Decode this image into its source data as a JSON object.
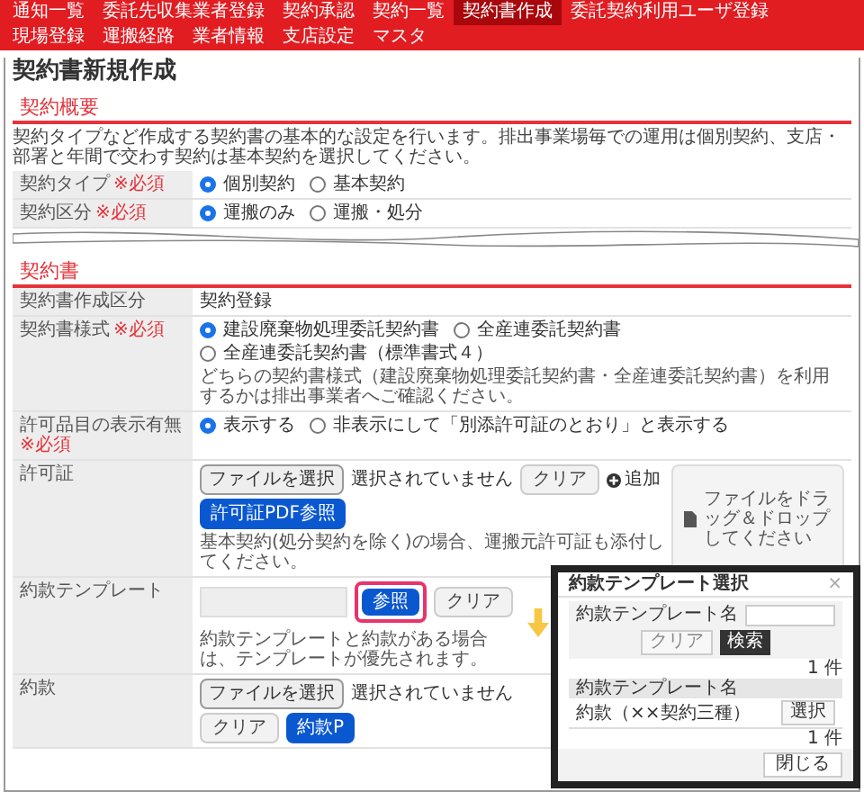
{
  "nav": [
    {
      "label": "通知一覧",
      "selected": false
    },
    {
      "label": "委託先収集業者登録",
      "selected": false
    },
    {
      "label": "契約承認",
      "selected": false
    },
    {
      "label": "契約一覧",
      "selected": false
    },
    {
      "label": "契約書作成",
      "selected": true
    },
    {
      "label": "委託契約利用ユーザ登録",
      "selected": false
    },
    {
      "label": "現場登録",
      "selected": false
    },
    {
      "label": "運搬経路",
      "selected": false
    },
    {
      "label": "業者情報",
      "selected": false
    },
    {
      "label": "支店設定",
      "selected": false
    },
    {
      "label": "マスタ",
      "selected": false
    }
  ],
  "page_title": "契約書新規作成",
  "overview": {
    "heading": "契約概要",
    "description": "契約タイプなど作成する契約書の基本的な設定を行います。排出事業場毎での運用は個別契約、支店・部署と年間で交わす契約は基本契約を選択してください。",
    "rows": [
      {
        "kind": "radio",
        "label": "契約タイプ",
        "required": "※必須",
        "options": [
          {
            "label": "個別契約",
            "selected": true
          },
          {
            "label": "基本契約",
            "selected": false
          }
        ]
      },
      {
        "kind": "radio",
        "label": "契約区分",
        "required": "※必須",
        "options": [
          {
            "label": "運搬のみ",
            "selected": true
          },
          {
            "label": "運搬・処分",
            "selected": false
          }
        ]
      }
    ]
  },
  "contract": {
    "heading": "契約書",
    "rows": [
      {
        "kind": "text",
        "label": "契約書作成区分",
        "value": "契約登録"
      },
      {
        "kind": "radio",
        "label": "契約書様式",
        "required": "※必須",
        "options": [
          {
            "label": "建設廃棄物処理委託契約書",
            "selected": true
          },
          {
            "label": "全産連委託契約書",
            "selected": false
          },
          {
            "label": "全産連委託契約書（標準書式４）",
            "selected": false
          }
        ],
        "note": "どちらの契約書様式（建設廃棄物処理委託契約書・全産連委託契約書）を利用するかは排出事業者へご確認ください。"
      },
      {
        "kind": "radio",
        "label": "許可品目の表示有無",
        "required": "※必須",
        "options": [
          {
            "label": "表示する",
            "selected": true
          },
          {
            "label": "非表示にして「別添許可証のとおり」と表示する",
            "selected": false
          }
        ]
      },
      {
        "kind": "file",
        "label": "許可証",
        "file_button": "ファイルを選択",
        "file_status": "選択されていません",
        "clear": "クリア",
        "add": "追加",
        "pdf_button": "許可証PDF参照",
        "dropzone": "ファイルをドラッグ＆ドロップしてください",
        "note": "基本契約(処分契約を除く)の場合、運搬元許可証も添付してください。"
      },
      {
        "kind": "template",
        "label": "約款テンプレート",
        "browse": "参照",
        "clear": "クリア",
        "note": "約款テンプレートと約款がある場合は、テンプレートが優先されます。"
      },
      {
        "kind": "file",
        "label": "約款",
        "file_button": "ファイルを選択",
        "file_status": "選択されていません",
        "clear": "クリア",
        "pdf_button": "約款P"
      }
    ]
  },
  "modal": {
    "title": "約款テンプレート選択",
    "close": "×",
    "search_label": "約款テンプレート名",
    "clear": "クリア",
    "search": "検索",
    "count_top": "1 件",
    "column": "約款テンプレート名",
    "rows": [
      {
        "name": "約款（××契約三種）",
        "action": "選択"
      }
    ],
    "count_bottom": "1 件",
    "close_button": "閉じる"
  }
}
